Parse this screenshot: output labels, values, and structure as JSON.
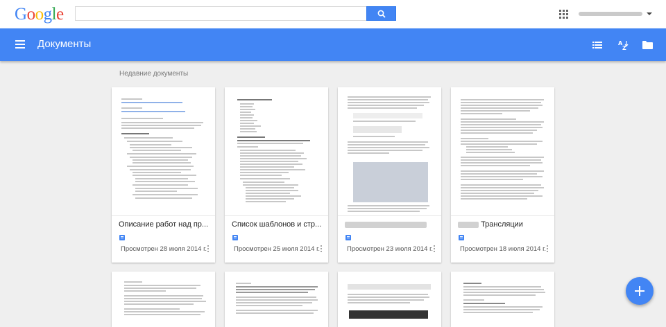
{
  "header": {
    "logo_text": "Google",
    "logo_colors": [
      "#4285f4",
      "#ea4335",
      "#fbbc05",
      "#4285f4",
      "#34a853",
      "#ea4335"
    ],
    "search_value": "",
    "search_icon": "search-icon",
    "apps_icon": "apps-grid-icon"
  },
  "appbar": {
    "title": "Документы",
    "accent": "#4285f4",
    "menu_icon": "menu-icon",
    "toolbar_icons": [
      "list-view-icon",
      "sort-az-icon",
      "folder-icon"
    ]
  },
  "section": {
    "title": "Недавние документы"
  },
  "documents": [
    {
      "title": "Описание работ над пр...",
      "meta": "Просмотрен 28 июля 2014 г."
    },
    {
      "title": "Список шаблонов и стр...",
      "meta": "Просмотрен 25 июля 2014 г."
    },
    {
      "title": "",
      "meta": "Просмотрен 23 июля 2014 г."
    },
    {
      "title": "Трансляции",
      "meta": "Просмотрен 18 июля 2014 г."
    }
  ],
  "fab": {
    "icon": "plus-icon"
  }
}
